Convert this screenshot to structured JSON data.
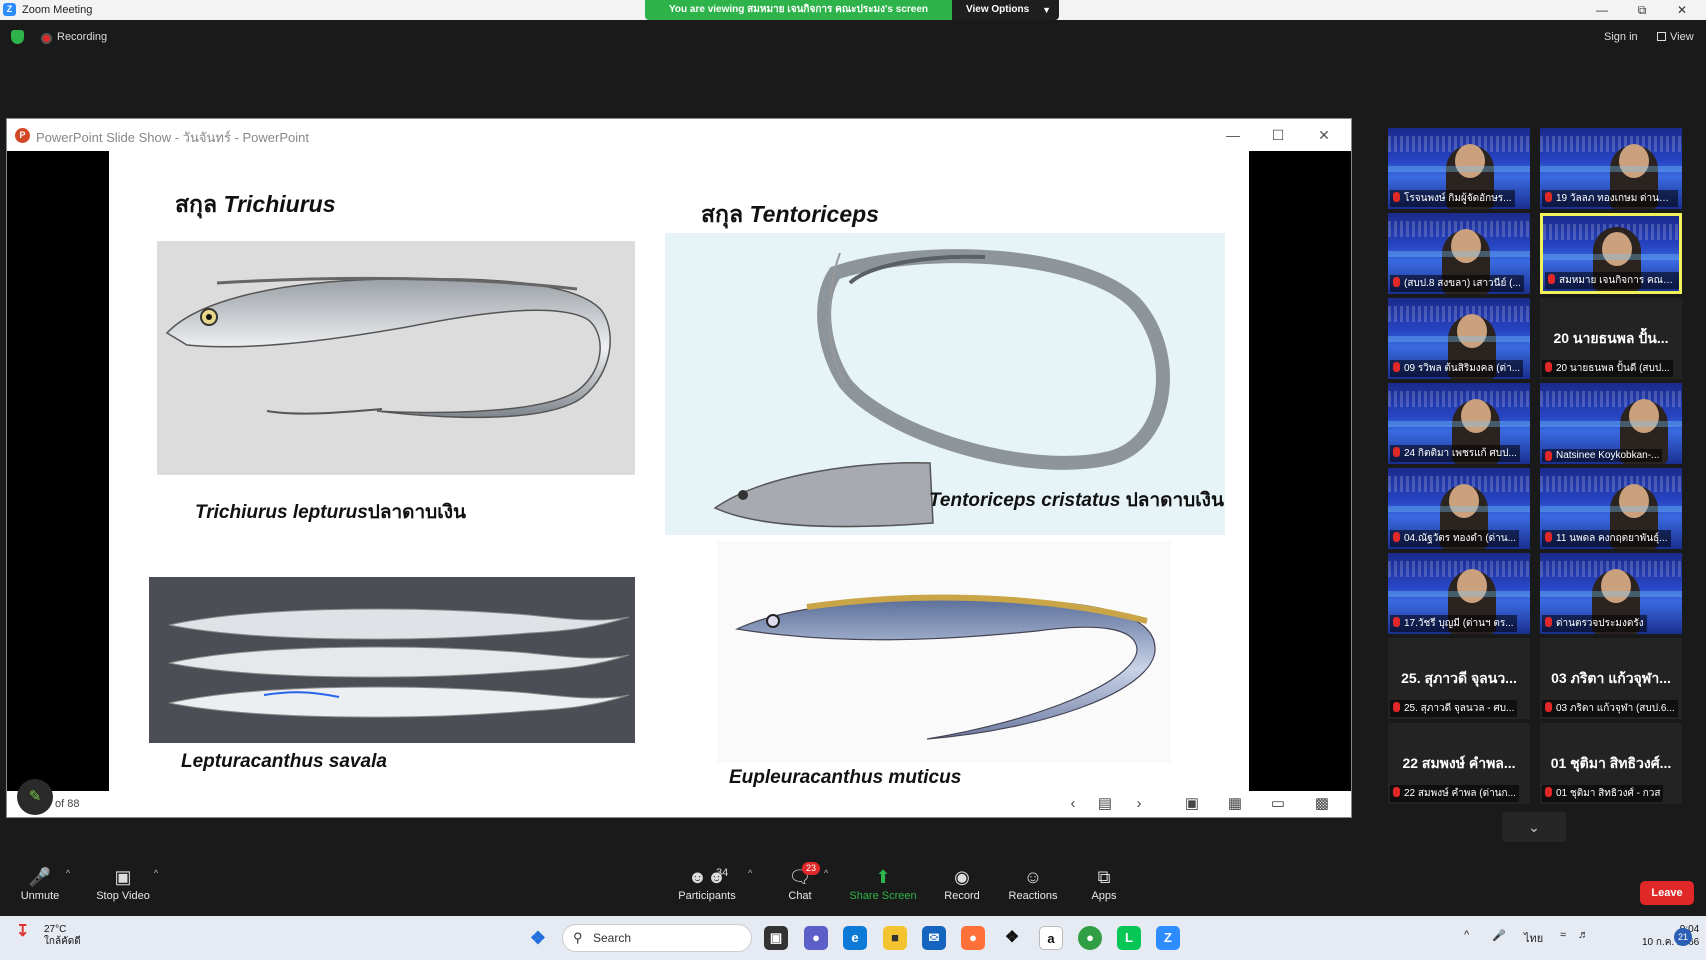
{
  "app": {
    "title": "Zoom Meeting",
    "logo": "Z"
  },
  "share_banner": {
    "text": "You are viewing สมหมาย เจนกิจการ คณะประมง's screen",
    "view_options": "View Options"
  },
  "recording": {
    "label": "Recording"
  },
  "topright": {
    "sign_in": "Sign in",
    "view": "View"
  },
  "powerpoint": {
    "title": "PowerPoint Slide Show  -  วันจันทร์ - PowerPoint",
    "slide_counter": "of 88",
    "slide": {
      "genus_left_prefix": "สกุล",
      "genus_left": "Trichiurus",
      "genus_right_prefix": "สกุล",
      "genus_right": "Tentoriceps",
      "cap1_sci": "Trichiurus  lepturus",
      "cap1_th": "ปลาดาบเงิน",
      "cap2_sci": "Tentoriceps cristatus",
      "cap2_th": "ปลาดาบเงิน",
      "cap3_sci": "Lepturacanthus savala",
      "cap4_sci": "Eupleuracanthus muticus"
    }
  },
  "gallery": [
    {
      "label": "โรจนพงษ์ กิมผู้จัดอักษร...",
      "type": "video"
    },
    {
      "label": "19 วัลลภ ทองเกษม ด่านตรวจ...",
      "type": "video"
    },
    {
      "label": "(สบป.8 สงขลา) เสาวนีย์ (...",
      "type": "video"
    },
    {
      "label": "สมหมาย  เจนกิจการ  คณะปร...",
      "type": "video",
      "active": true
    },
    {
      "label": "09 รวิพล ต้นสิริมงคล (ด่า...",
      "type": "video"
    },
    {
      "label": "20 นายธนพล ปั้นดี (สบป...",
      "type": "name",
      "big": "20 นายธนพล ปั้น..."
    },
    {
      "label": "24 กิตติมา เพชรแก้ ศบป...",
      "type": "video"
    },
    {
      "label": "Natsinee Koykobkan-...",
      "type": "video"
    },
    {
      "label": "04.ณัฐวัตร ทองดำ (ด่าน...",
      "type": "video"
    },
    {
      "label": "11 นพดล คงกฤตยาพันธุ์...",
      "type": "video"
    },
    {
      "label": "17.วัชรี บุญมี  (ด่านฯ ตร...",
      "type": "video"
    },
    {
      "label": "ด่านตรวจประมงตรัง",
      "type": "video"
    },
    {
      "label": "25. สุภาวดี จุลนวล - ศบ...",
      "type": "name",
      "big": "25. สุภาวดี จุลนว..."
    },
    {
      "label": "03 ภริตา แก้วจุฬา (สบป.6...",
      "type": "name",
      "big": "03 ภริตา แก้วจุฬา..."
    },
    {
      "label": "22 สมพงษ์ คำพล (ด่านก...",
      "type": "name",
      "big": "22 สมพงษ์ คำพล..."
    },
    {
      "label": "01 ชุติมา สิทธิวงศ์ - กวส",
      "type": "name",
      "big": "01 ชุติมา สิทธิวงศ์..."
    }
  ],
  "toolbar": {
    "unmute": "Unmute",
    "stop_video": "Stop Video",
    "participants": "Participants",
    "participants_count": "34",
    "chat": "Chat",
    "chat_badge": "23",
    "share_screen": "Share Screen",
    "record": "Record",
    "reactions": "Reactions",
    "apps": "Apps",
    "leave": "Leave"
  },
  "taskbar": {
    "temp": "27°C",
    "weather": "ใกล้คัดดี",
    "search": "Search",
    "lang": "ไทย",
    "time": "9:04",
    "date": "10 ก.ค. 2566",
    "notif": "21"
  }
}
